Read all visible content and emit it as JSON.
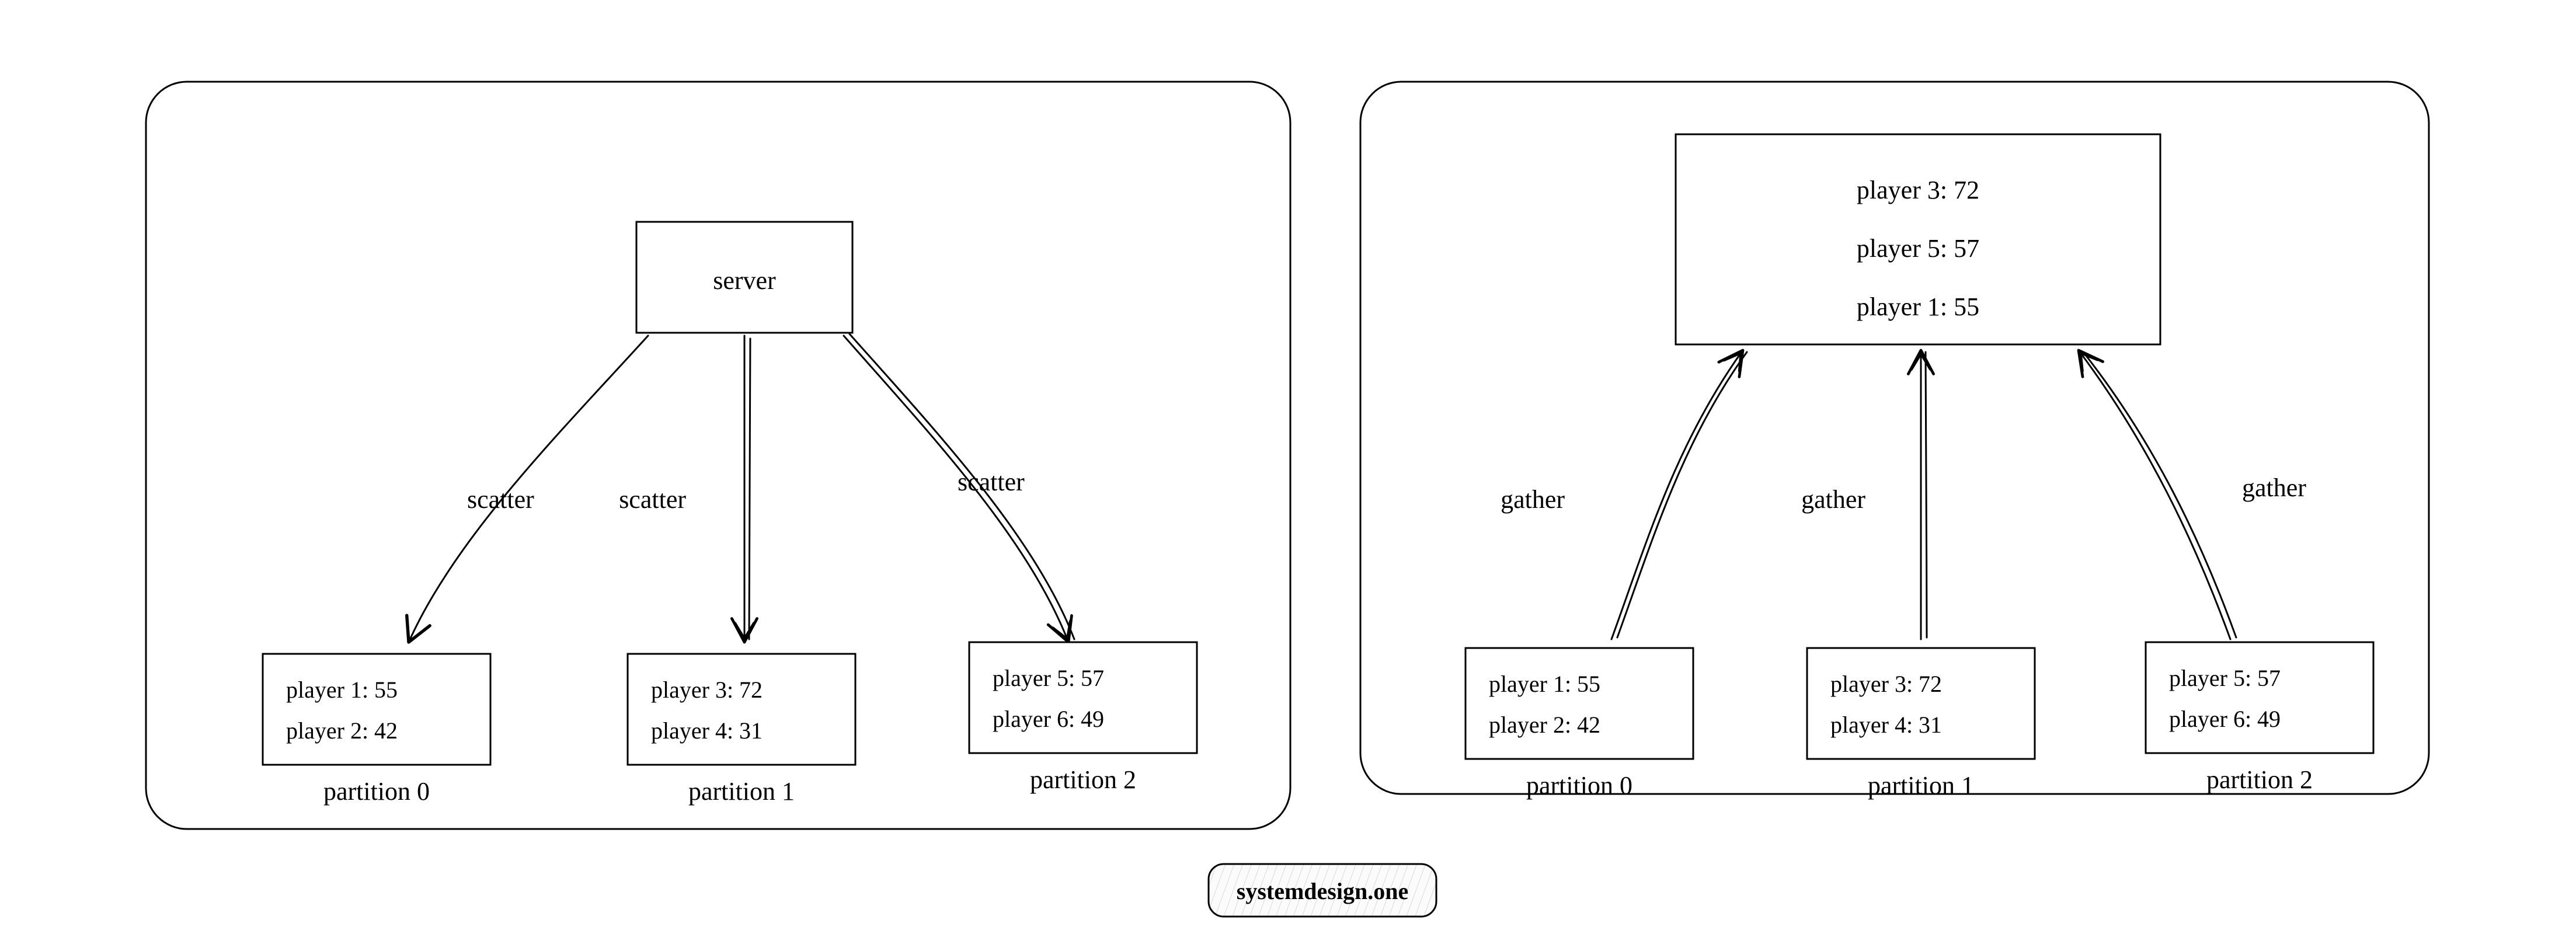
{
  "footer": {
    "watermark": "systemdesign.one"
  },
  "left": {
    "server_label": "server",
    "arrow_label": "scatter",
    "partitions": [
      {
        "label": "partition 0",
        "lines": [
          "player 1: 55",
          "player 2: 42"
        ]
      },
      {
        "label": "partition 1",
        "lines": [
          "player 3: 72",
          "player 4: 31"
        ]
      },
      {
        "label": "partition 2",
        "lines": [
          "player 5: 57",
          "player 6: 49"
        ]
      }
    ]
  },
  "right": {
    "arrow_label": "gather",
    "result_lines": [
      "player 3: 72",
      "player 5: 57",
      "player 1: 55"
    ],
    "partitions": [
      {
        "label": "partition 0",
        "lines": [
          "player 1: 55",
          "player 2: 42"
        ]
      },
      {
        "label": "partition 1",
        "lines": [
          "player 3: 72",
          "player 4: 31"
        ]
      },
      {
        "label": "partition 2",
        "lines": [
          "player 5: 57",
          "player 6: 49"
        ]
      }
    ]
  }
}
